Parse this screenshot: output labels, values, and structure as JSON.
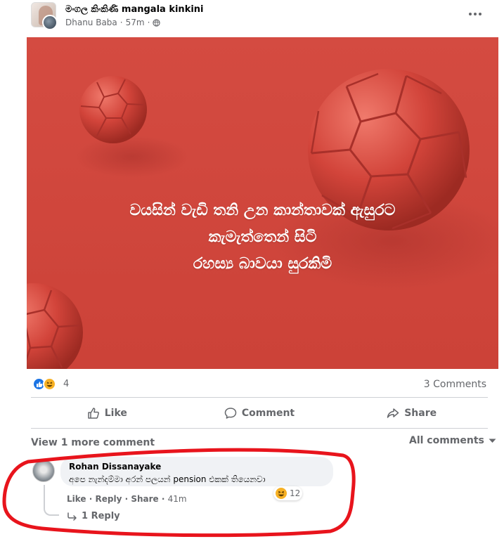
{
  "post": {
    "group_name": "මංගල කිංකිණි mangala kinkini",
    "author": "Dhanu Baba",
    "time": "57m",
    "separator": "·",
    "more_icon": "more-horizontal-icon"
  },
  "image": {
    "background_color": "#d0453b",
    "caption_lines": [
      "වයසින් වැඩි තනි උන කාන්තාවක් ඇසුරට",
      "කැමැත්තෙන් සිටි",
      "රහස්‍ය බාවයා සුරකිමි"
    ]
  },
  "reactions": {
    "count": "4",
    "types": [
      "like",
      "haha"
    ],
    "comments_label": "3 Comments"
  },
  "actions": {
    "like": "Like",
    "comment": "Comment",
    "share": "Share"
  },
  "comments_section": {
    "view_more": "View 1 more comment",
    "filter": "All comments"
  },
  "comment": {
    "name": "Rohan Dissanayake",
    "text": "අපෙ නැන්දම්මා අරන් පලයන් pension එකක් තියෙනවා",
    "reaction_count": "12",
    "like": "Like",
    "reply": "Reply",
    "share": "Share",
    "time": "41m",
    "sep": " · ",
    "replies": "1 Reply"
  },
  "colors": {
    "accent_blue": "#1b74e4",
    "muted_text": "#65676b",
    "annotation_red": "#e8141c"
  }
}
